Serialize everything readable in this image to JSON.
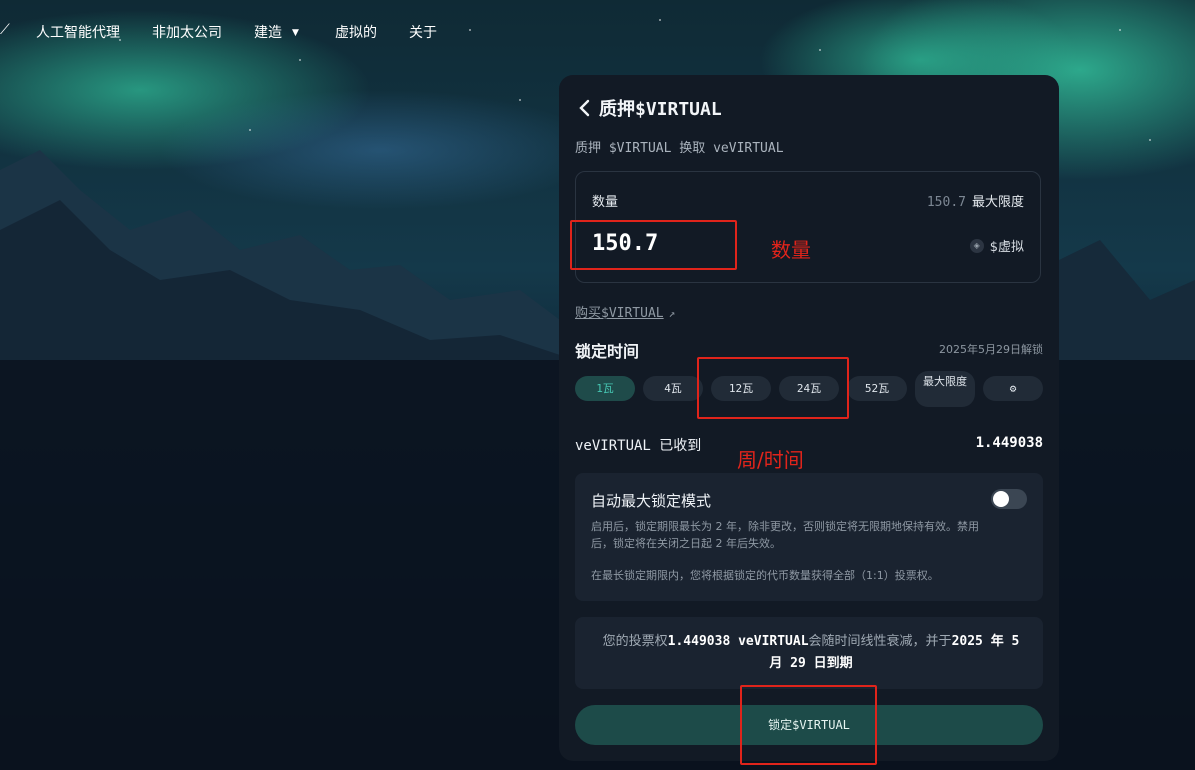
{
  "nav": {
    "logo": "⟋",
    "items": [
      "人工智能代理",
      "非加太公司",
      "建造",
      "虚拟的",
      "关于"
    ],
    "dropdown_caret": "▼"
  },
  "panel": {
    "back_icon": "chevron-left-icon",
    "title": "质押$VIRTUAL",
    "subtitle": "质押 $VIRTUAL 换取 veVIRTUAL",
    "amount": {
      "label": "数量",
      "max_value": "150.7",
      "max_label": "最大限度",
      "value": "150.7",
      "token_icon": "◈",
      "token": "$虚拟"
    },
    "buy_link": "购买$VIRTUAL",
    "buy_icon": "↗",
    "lock": {
      "title": "锁定时间",
      "unlock_date": "2025年5月29日解锁",
      "options": [
        "1瓦",
        "4瓦",
        "12瓦",
        "24瓦",
        "52瓦",
        "最大限度"
      ],
      "selected": "1瓦",
      "settings_icon": "⚙"
    },
    "receive": {
      "label": "veVIRTUAL 已收到",
      "value": "1.449038"
    },
    "auto_max": {
      "title": "自动最大锁定模式",
      "enabled": false,
      "description": "启用后，锁定期限最长为 2 年，除非更改，否则锁定将无限期地保持有效。禁用后，锁定将在关闭之日起 2 年后失效。",
      "note": "在最长锁定期限内，您将根据锁定的代币数量获得全部（1:1）投票权。"
    },
    "vote": {
      "prefix": "您的投票权",
      "amount": "1.449038 veVIRTUAL",
      "middle": "会随时间线性衰减，并于",
      "date": "2025 年 5 月 29 日到期"
    },
    "lock_button": "锁定$VIRTUAL"
  },
  "annotations": {
    "amount_label": "数量",
    "week_time_label": "周/时间",
    "color": "#e0241b"
  }
}
